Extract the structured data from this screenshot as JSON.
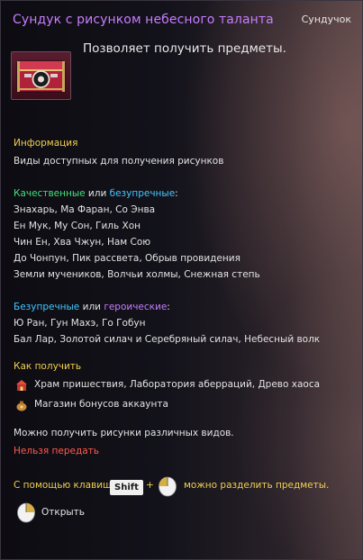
{
  "header": {
    "title": "Сундук с рисунком небесного таланта",
    "category": "Сундучок"
  },
  "summary": "Позволяет получить предметы.",
  "info": {
    "heading": "Информация",
    "text": "Виды доступных для получения рисунков"
  },
  "group1": {
    "label_a": "Качественные",
    "conj": "или",
    "label_b": "безупречные",
    "colon": ":",
    "lines": [
      "Знахарь, Ма Фаран, Со Энва",
      "Ен Мук, Му Сон, Гиль Хон",
      "Чин Ен, Хва Чжун, Нам Сою",
      "До Чонпун, Пик рассвета, Обрыв провидения",
      "Земли мучеников, Волчьи холмы, Снежная степь"
    ]
  },
  "group2": {
    "label_a": "Безупречные",
    "conj": "или",
    "label_b": "героические",
    "colon": ":",
    "lines": [
      "Ю Ран, Гун Махэ, Го Гобун",
      "Бал Лар, Золотой силач и Серебряный силач, Небесный волк"
    ]
  },
  "obtain": {
    "heading": "Как получить",
    "sources": [
      {
        "icon": "shrine-icon",
        "text": "Храм пришествия, Лаборатория аберраций, Древо хаоса"
      },
      {
        "icon": "bag-icon",
        "text": "Магазин бонусов аккаунта"
      }
    ]
  },
  "note": "Можно получить рисунки различных видов.",
  "restriction": "Нельзя передать",
  "split_hint": {
    "prefix": "С помощью клавиш",
    "key": "Shift",
    "plus": "+",
    "suffix": "можно разделить предметы."
  },
  "open_label": "Открыть",
  "colors": {
    "title": "#c77dff",
    "heading": "#f0cf4f",
    "good": "#3ee07a",
    "flawless": "#43c7ff",
    "heroic": "#c77dff",
    "warning": "#ff5a4f"
  }
}
